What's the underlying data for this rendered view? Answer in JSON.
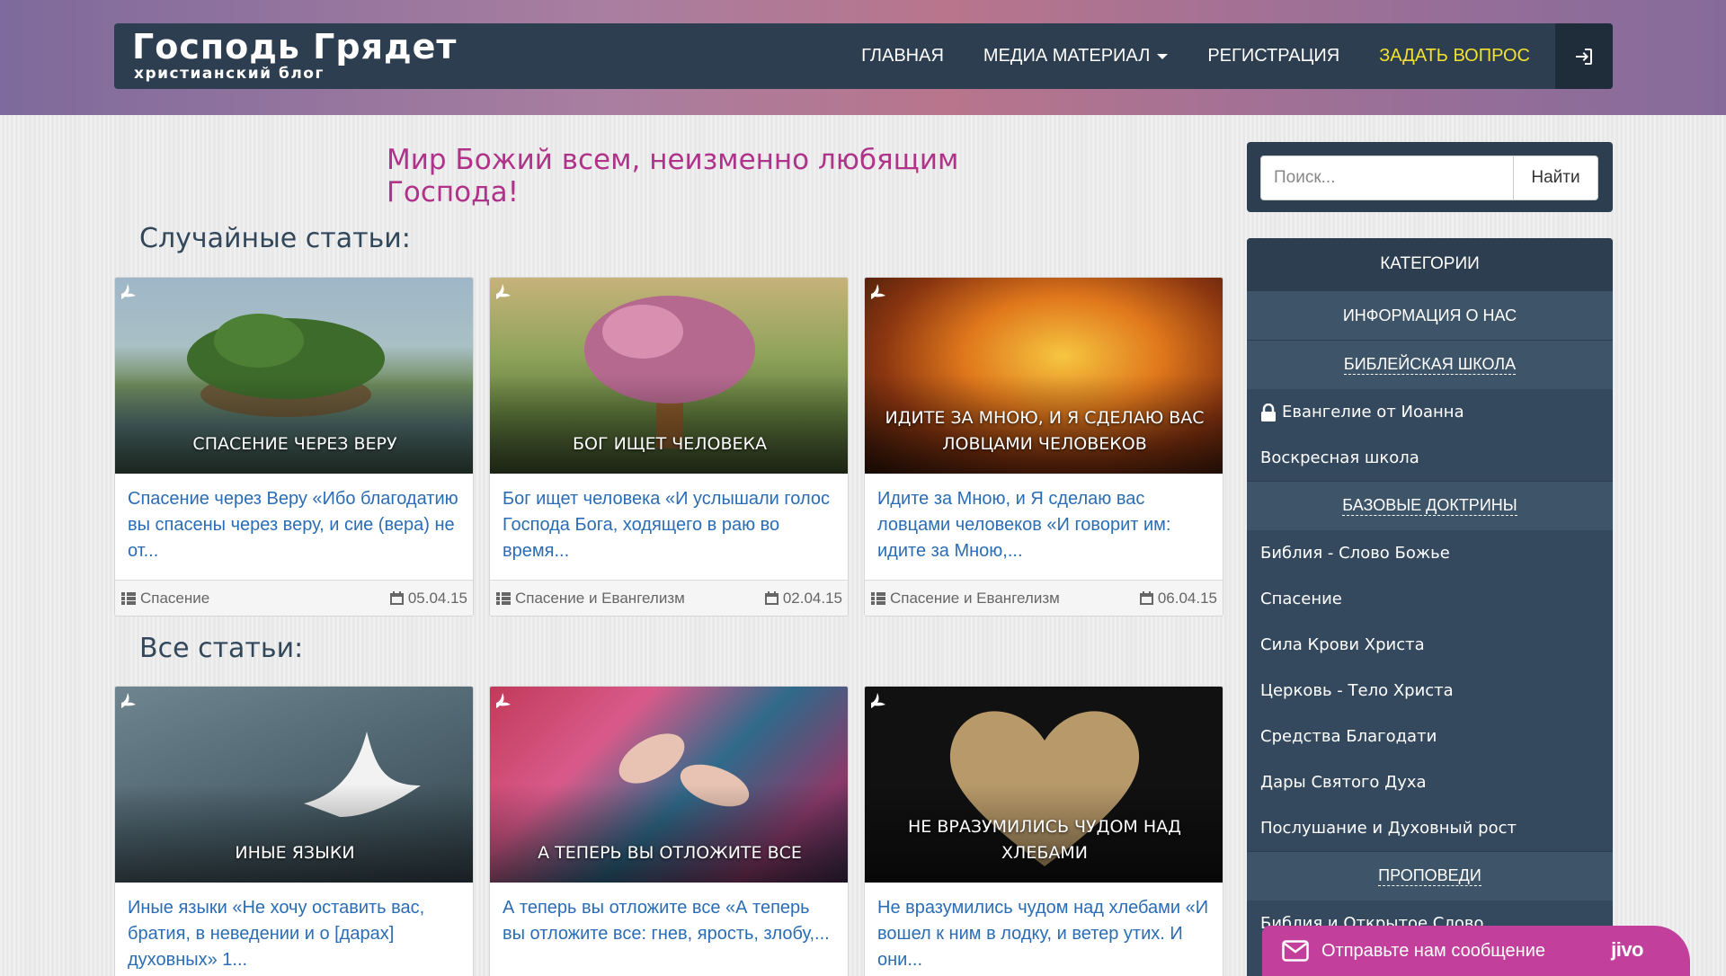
{
  "brand": {
    "title": "Господь Грядет",
    "subtitle": "христианский блог"
  },
  "nav": {
    "home": "ГЛАВНАЯ",
    "media": "МЕДИА МАТЕРИАЛ",
    "register": "РЕГИСТРАЦИЯ",
    "ask": "ЗАДАТЬ ВОПРОС"
  },
  "welcome": "Мир Божий всем, неизменно любящим Господа!",
  "random_title": "Случайные статьи:",
  "all_title": "Все статьи:",
  "random_articles": [
    {
      "caption": "СПАСЕНИЕ ЧЕРЕЗ ВЕРУ",
      "excerpt": "Спасение через Веру «Ибо благодатию вы спасены через веру, и сие (вера) не от...",
      "category": "Спасение",
      "date": "05.04.15"
    },
    {
      "caption": "БОГ ИЩЕТ ЧЕЛОВЕКА",
      "excerpt": "Бог ищет человека «И услышали голос Господа Бога, ходящего в раю во время...",
      "category": "Спасение и Евангелизм",
      "date": "02.04.15"
    },
    {
      "caption": "ИДИТЕ ЗА МНОЮ, И Я СДЕЛАЮ ВАС ЛОВЦАМИ ЧЕЛОВЕКОВ",
      "excerpt": "Идите за Мною, и Я сделаю вас ловцами человеков «И говорит им: идите за Мною,...",
      "category": "Спасение и Евангелизм",
      "date": "06.04.15"
    }
  ],
  "all_articles": [
    {
      "caption": "ИНЫЕ ЯЗЫКИ",
      "excerpt": "Иные языки «Не хочу оставить вас, братия, в неведении и о [дарах] духовных» 1..."
    },
    {
      "caption": "А ТЕПЕРЬ ВЫ ОТЛОЖИТЕ ВСЕ",
      "excerpt": "А теперь вы отложите все «А теперь вы отложите все: гнев, ярость, злобу,..."
    },
    {
      "caption": "НЕ ВРАЗУМИЛИСЬ ЧУДОМ НАД ХЛЕБАМИ",
      "excerpt": "Не вразумились чудом над хлебами «И вошел к ним в лодку, и ветер утих. И они..."
    }
  ],
  "search": {
    "placeholder": "Поиск...",
    "button": "Найти"
  },
  "categories": {
    "title": "КАТЕГОРИИ",
    "info": "ИНФОРМАЦИЯ О НАС",
    "bible_school": "БИБЛЕЙСКАЯ ШКОЛА",
    "bible_school_items": [
      "Евангелие от Иоанна",
      "Воскресная школа"
    ],
    "doctrines": "БАЗОВЫЕ ДОКТРИНЫ",
    "doctrine_items": [
      "Библия - Слово Божье",
      "Спасение",
      "Сила Крови Христа",
      "Церковь - Тело Христа",
      "Средства Благодати",
      "Дары Святого Духа",
      "Послушание и Духовный рост"
    ],
    "sermons": "ПРОПОВЕДИ",
    "sermon_items": [
      "Библия и Открытое Слово"
    ]
  },
  "chat": {
    "label": "Отправьте нам сообщение",
    "logo": "jivo"
  },
  "colors": {
    "navbar": "#2d3e50",
    "accent": "#f2e230",
    "welcome": "#b0338a",
    "link": "#2a6db5",
    "chat": "#c23f9c"
  }
}
